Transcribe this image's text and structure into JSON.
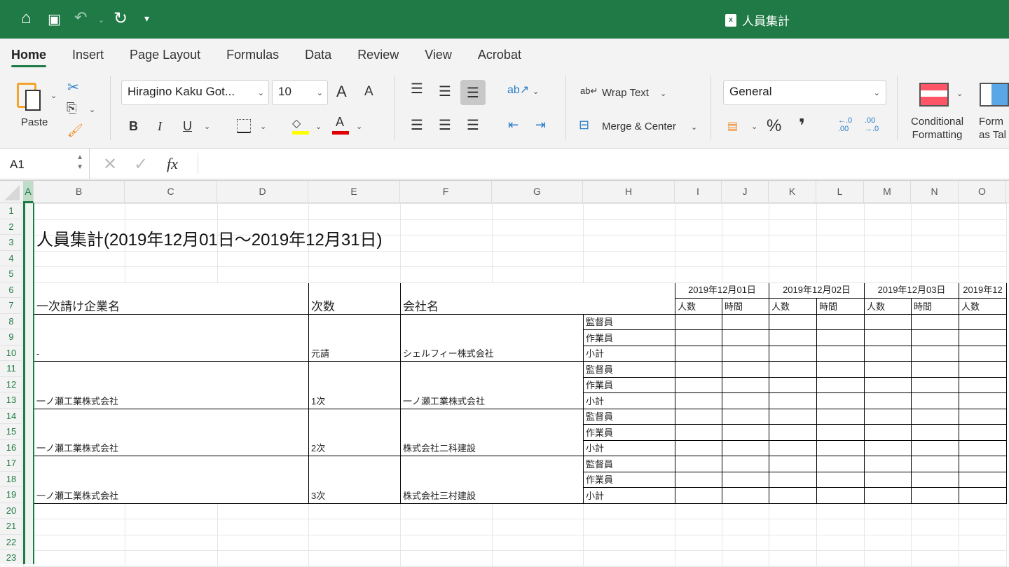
{
  "titlebar": {
    "doc_title": "人員集計",
    "badge": "x"
  },
  "tabs": [
    "Home",
    "Insert",
    "Page Layout",
    "Formulas",
    "Data",
    "Review",
    "View",
    "Acrobat"
  ],
  "ribbon": {
    "paste": "Paste",
    "font_name": "Hiragino Kaku Got...",
    "font_size": "10",
    "bold": "B",
    "italic": "I",
    "underline": "U",
    "grow": "A",
    "shrink": "A",
    "font_color": "A",
    "wrap_text": "Wrap Text",
    "merge_center": "Merge & Center",
    "number_format": "General",
    "percent": "%",
    "comma": "❜",
    "inc_dec": "←.0\n.00",
    "dec_dec": ".00\n→.0",
    "conditional": "Conditional",
    "formatting": "Formatting",
    "format_as": "Form",
    "as_table": "as Tal",
    "colors": {
      "fill": "#ffff00",
      "font": "#e00000",
      "accent": "#1f7a46"
    }
  },
  "formula_bar": {
    "name_box": "A1",
    "formula": "",
    "fx": "fx"
  },
  "columns": [
    "A",
    "B",
    "C",
    "D",
    "E",
    "F",
    "G",
    "H",
    "I",
    "J",
    "K",
    "L",
    "M",
    "N",
    "O"
  ],
  "rows": [
    "1",
    "2",
    "3",
    "4",
    "5",
    "6",
    "7",
    "8",
    "9",
    "10",
    "11",
    "12",
    "13",
    "14",
    "15",
    "16",
    "17",
    "18",
    "19",
    "20",
    "21",
    "22",
    "23"
  ],
  "sheet": {
    "title": "人員集計(2019年12月01日～2019年12月31日)",
    "headers": {
      "primary": "一次請け企業名",
      "tier": "次数",
      "company": "会社名",
      "headcount": "人数",
      "hours": "時間"
    },
    "dates": [
      "2019年12月01日",
      "2019年12月02日",
      "2019年12月03日",
      "2019年12"
    ],
    "roles": [
      "監督員",
      "作業員",
      "小計"
    ],
    "groups": [
      {
        "primary": "-",
        "tier": "元請",
        "company": "シェルフィー株式会社"
      },
      {
        "primary": "一ノ瀬工業株式会社",
        "tier": "1次",
        "company": "一ノ瀬工業株式会社"
      },
      {
        "primary": "一ノ瀬工業株式会社",
        "tier": "2次",
        "company": "株式会社二科建設"
      },
      {
        "primary": "一ノ瀬工業株式会社",
        "tier": "3次",
        "company": "株式会社三村建設"
      }
    ]
  }
}
